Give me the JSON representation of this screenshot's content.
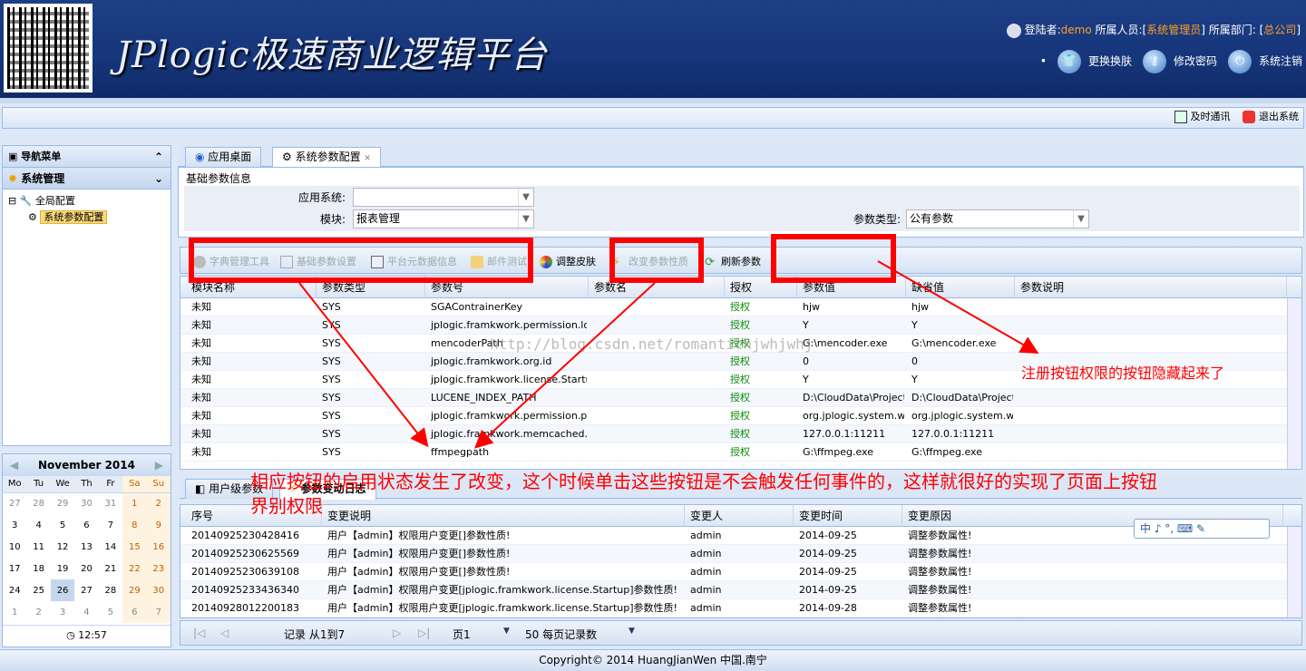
{
  "header": {
    "logo": "JPlogic极速商业逻辑平台",
    "login_label": "登陆者:",
    "user": "demo",
    "staff_label": "所属人员:[",
    "staff": "系统管理员",
    "dept_label": "] 所属部门: [",
    "dept": "总公司",
    "dept_end": "]",
    "skin": "更换换肤",
    "password": "修改密码",
    "logout": "系统注销"
  },
  "topbar": {
    "im": "及时通讯",
    "exit": "退出系统"
  },
  "sidebar": {
    "nav_title": "导航菜单",
    "section": "系统管理",
    "tree_root": "全局配置",
    "tree_leaf": "系统参数配置"
  },
  "calendar": {
    "month": "November 2014",
    "days": [
      "Mo",
      "Tu",
      "We",
      "Th",
      "Fr",
      "Sa",
      "Su"
    ],
    "weeks": [
      [
        "27",
        "28",
        "29",
        "30",
        "31",
        "1",
        "2"
      ],
      [
        "3",
        "4",
        "5",
        "6",
        "7",
        "8",
        "9"
      ],
      [
        "10",
        "11",
        "12",
        "13",
        "14",
        "15",
        "16"
      ],
      [
        "17",
        "18",
        "19",
        "20",
        "21",
        "22",
        "23"
      ],
      [
        "24",
        "25",
        "26",
        "27",
        "28",
        "29",
        "30"
      ],
      [
        "1",
        "2",
        "3",
        "4",
        "5",
        "6",
        "7"
      ]
    ],
    "time": "12:57"
  },
  "tabs": {
    "desktop": "应用桌面",
    "config": "系统参数配置"
  },
  "form": {
    "legend": "基础参数信息",
    "app_label": "应用系统:",
    "module_label": "模块:",
    "module_value": "报表管理",
    "type_label": "参数类型:",
    "type_value": "公有参数"
  },
  "toolbar": {
    "dict": "字典管理工具",
    "basic": "基础参数设置",
    "meta": "平台元数据信息",
    "mail": "邮件测试",
    "skin": "调整皮肤",
    "change": "改变参数性质",
    "refresh": "刷新参数"
  },
  "grid1": {
    "headers": [
      "模块名称",
      "参数类型",
      "参数号",
      "参数名",
      "授权",
      "参数值",
      "缺省值",
      "参数说明"
    ],
    "rows": [
      [
        "未知",
        "SYS",
        "SGAContrainerKey",
        "",
        "授权",
        "hjw",
        "hjw",
        ""
      ],
      [
        "未知",
        "SYS",
        "jplogic.framkwork.permission.loadPe",
        "",
        "授权",
        "Y",
        "Y",
        ""
      ],
      [
        "未知",
        "SYS",
        "mencoderPath",
        "",
        "授权",
        "G:\\mencoder.exe",
        "G:\\mencoder.exe",
        ""
      ],
      [
        "未知",
        "SYS",
        "jplogic.framkwork.org.id",
        "",
        "授权",
        "0",
        "0",
        ""
      ],
      [
        "未知",
        "SYS",
        "jplogic.framkwork.license.Startup",
        "",
        "授权",
        "Y",
        "Y",
        ""
      ],
      [
        "未知",
        "SYS",
        "LUCENE_INDEX_PATH",
        "",
        "授权",
        "D:\\CloudData\\Projects\\j",
        "D:\\CloudData\\Projects\\j",
        ""
      ],
      [
        "未知",
        "SYS",
        "jplogic.framkwork.permission.packag",
        "",
        "授权",
        "org.jplogic.system.web.",
        "org.jplogic.system.web.",
        ""
      ],
      [
        "未知",
        "SYS",
        "jplogic.framkwork.memcached.cache",
        "",
        "授权",
        "127.0.0.1:11211",
        "127.0.0.1:11211",
        ""
      ],
      [
        "未知",
        "SYS",
        "ffmpegpath",
        "",
        "授权",
        "G:\\ffmpeg.exe",
        "G:\\ffmpeg.exe",
        ""
      ]
    ]
  },
  "tabs2": {
    "user_params": "用户级参数",
    "log": "参数变动日志"
  },
  "grid2": {
    "headers": [
      "序号",
      "变更说明",
      "变更人",
      "变更时间",
      "变更原因"
    ],
    "rows": [
      [
        "20140925230428416",
        "用户【admin】权限用户变更[]参数性质!",
        "admin",
        "2014-09-25",
        "调整参数属性!"
      ],
      [
        "20140925230625569",
        "用户【admin】权限用户变更[]参数性质!",
        "admin",
        "2014-09-25",
        "调整参数属性!"
      ],
      [
        "20140925230639108",
        "用户【admin】权限用户变更[]参数性质!",
        "admin",
        "2014-09-25",
        "调整参数属性!"
      ],
      [
        "20140925233436340",
        "用户【admin】权限用户变更[jplogic.framkwork.license.Startup]参数性质!",
        "admin",
        "2014-09-25",
        "调整参数属性!"
      ],
      [
        "20140928012200183",
        "用户【admin】权限用户变更[jplogic.framkwork.license.Startup]参数性质!",
        "admin",
        "2014-09-28",
        "调整参数属性!"
      ]
    ]
  },
  "pager": {
    "records": "记录 从1到7",
    "page": "页1",
    "per_page": "50 每页记录数"
  },
  "ime": "中 ♪ °, ⌨ ✎",
  "watermark": "http://blog.csdn.net/romantichjwhjwhj",
  "footer": "Copyright© 2014 HuangJianWen 中国.南宁",
  "annotations": {
    "right": "注册按钮权限的按钮隐藏起来了",
    "bottom": "相应按钮的启用状态发生了改变，这个时候单击这些按钮是不会触发任何事件的，这样就很好的实现了页面上按钮界别权限"
  },
  "colors": {
    "header_bg": "#16357a",
    "accent": "#ffa020",
    "annotation": "#ff0000",
    "border": "#99bbe8"
  }
}
